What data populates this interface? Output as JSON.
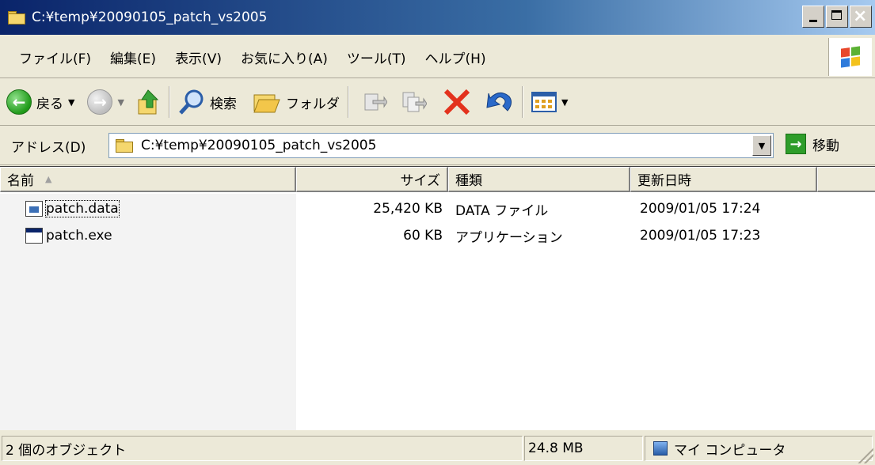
{
  "window": {
    "title": "C:¥temp¥20090105_patch_vs2005"
  },
  "menu": {
    "items": [
      "ファイル(F)",
      "編集(E)",
      "表示(V)",
      "お気に入り(A)",
      "ツール(T)",
      "ヘルプ(H)"
    ]
  },
  "toolbar": {
    "back_label": "戻る",
    "search_label": "検索",
    "folders_label": "フォルダ"
  },
  "address": {
    "label": "アドレス(D)",
    "value": "C:¥temp¥20090105_patch_vs2005",
    "go_label": "移動"
  },
  "columns": {
    "name": "名前",
    "size": "サイズ",
    "type": "種類",
    "modified": "更新日時"
  },
  "files": [
    {
      "name": "patch.data",
      "size": "25,420 KB",
      "type": "DATA ファイル",
      "modified": "2009/01/05 17:24",
      "icon": "data-file-icon"
    },
    {
      "name": "patch.exe",
      "size": "60 KB",
      "type": "アプリケーション",
      "modified": "2009/01/05 17:23",
      "icon": "exe-icon"
    }
  ],
  "status": {
    "objects": "2 個のオブジェクト",
    "total_size": "24.8 MB",
    "location": "マイ コンピュータ"
  },
  "colors": {
    "titlebar_start": "#0a246a",
    "titlebar_end": "#a6caf0",
    "chrome": "#ece9d8"
  }
}
